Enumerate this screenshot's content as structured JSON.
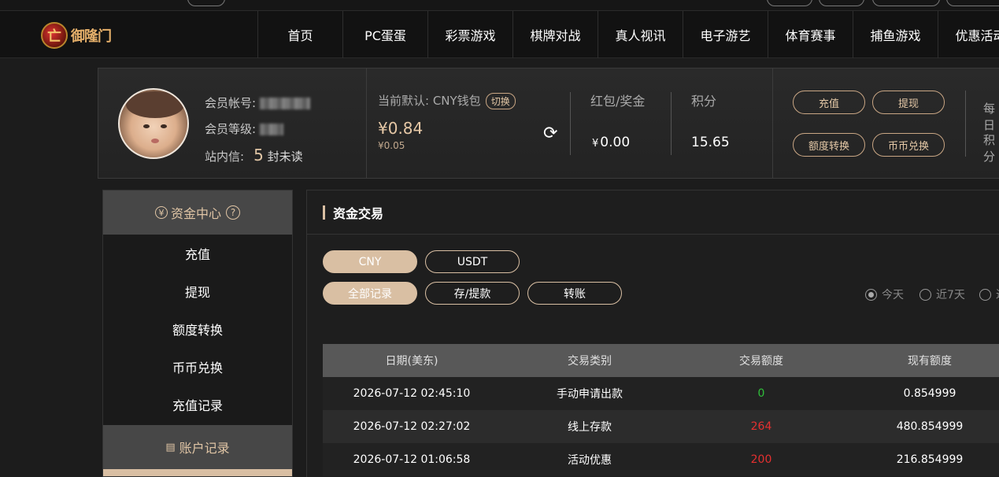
{
  "logo": {
    "mark": "亡",
    "text": "御隆门"
  },
  "nav": [
    "首页",
    "PC蛋蛋",
    "彩票游戏",
    "棋牌对战",
    "真人视讯",
    "电子游艺",
    "体育赛事",
    "捕鱼游戏",
    "优惠活动"
  ],
  "profile": {
    "account_label": "会员帐号:",
    "level_label": "会员等级:",
    "level_value": "VIP1",
    "messages_label": "站内信:",
    "unread_count": "5",
    "unread_text": "封未读",
    "wallet_label": "当前默认: CNY钱包",
    "switch_label": "切换",
    "balance": "¥0.84",
    "balance_sub": "¥0.05",
    "bonus_label": "红包/奖金",
    "bonus_currency": "¥",
    "bonus_value": "0.00",
    "points_label": "积分",
    "points_value": "15.65",
    "buttons": {
      "recharge": "充值",
      "withdraw": "提现",
      "transfer": "额度转换",
      "exchange": "币币兑换"
    },
    "edge1": "每日",
    "edge2": "积分"
  },
  "sidebar": {
    "head": "资金中心",
    "head_icon": "¥",
    "help": "?",
    "items": [
      "充值",
      "提现",
      "额度转换",
      "币币兑换",
      "充值记录"
    ],
    "head2": "账户记录"
  },
  "main": {
    "title": "资金交易",
    "currency_tabs": [
      "CNY",
      "USDT"
    ],
    "record_tabs": [
      "全部记录",
      "存/提款",
      "转账"
    ],
    "ranges": [
      "今天",
      "近7天",
      "近"
    ],
    "table": {
      "headers": [
        "日期(美东)",
        "交易类别",
        "交易额度",
        "现有额度"
      ],
      "rows": [
        [
          "2026-07-12 02:45:10",
          "手动申请出款",
          "0",
          "0.854999"
        ],
        [
          "2026-07-12 02:27:02",
          "线上存款",
          "264",
          "480.854999"
        ],
        [
          "2026-07-12 01:06:58",
          "活动优惠",
          "200",
          "216.854999"
        ]
      ]
    }
  },
  "colors": {
    "accent": "#d9bfa3",
    "gold": "#e6c8a6",
    "positive": "#2fbf3a",
    "negative": "#e53030"
  }
}
